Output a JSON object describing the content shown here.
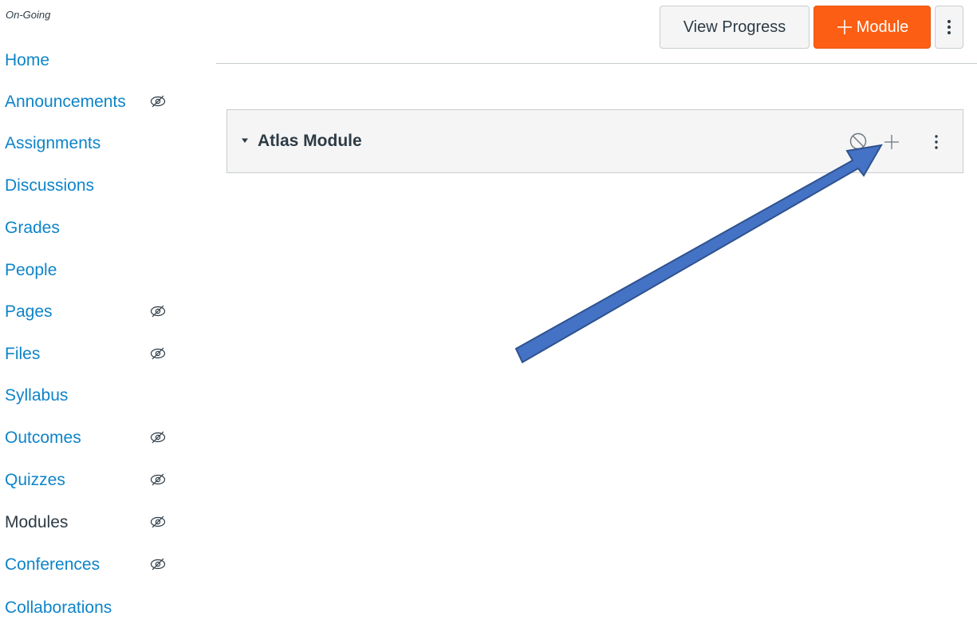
{
  "course": {
    "term_label": "On-Going"
  },
  "sidebar": {
    "items": [
      {
        "label": "Home",
        "hidden": false,
        "active": false
      },
      {
        "label": "Announcements",
        "hidden": true,
        "active": false
      },
      {
        "label": "Assignments",
        "hidden": false,
        "active": false
      },
      {
        "label": "Discussions",
        "hidden": false,
        "active": false
      },
      {
        "label": "Grades",
        "hidden": false,
        "active": false
      },
      {
        "label": "People",
        "hidden": false,
        "active": false
      },
      {
        "label": "Pages",
        "hidden": true,
        "active": false
      },
      {
        "label": "Files",
        "hidden": true,
        "active": false
      },
      {
        "label": "Syllabus",
        "hidden": false,
        "active": false
      },
      {
        "label": "Outcomes",
        "hidden": true,
        "active": false
      },
      {
        "label": "Quizzes",
        "hidden": true,
        "active": false
      },
      {
        "label": "Modules",
        "hidden": true,
        "active": true
      },
      {
        "label": "Conferences",
        "hidden": true,
        "active": false
      },
      {
        "label": "Collaborations",
        "hidden": false,
        "active": false
      }
    ]
  },
  "toolbar": {
    "view_progress_label": "View Progress",
    "add_module_label": "Module",
    "add_module_icon": "plus-icon",
    "more_icon": "kebab-icon"
  },
  "module": {
    "title": "Atlas Module",
    "collapse_icon": "caret-down-icon",
    "icons": [
      "unpublished-icon",
      "plus-icon",
      "kebab-icon"
    ]
  },
  "colors": {
    "link": "#0e84c8",
    "text": "#2d3b45",
    "accent": "#fc5e13",
    "annotation_arrow": "#4472c4"
  }
}
